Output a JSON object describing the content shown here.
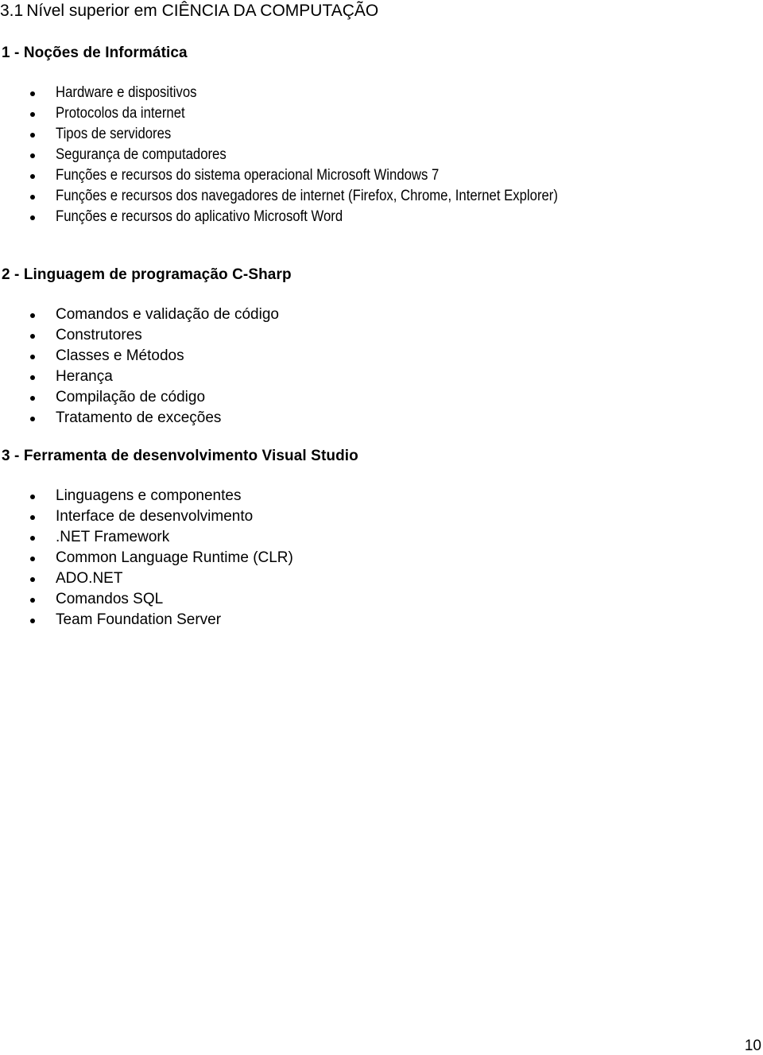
{
  "document": {
    "title_number": "3.1",
    "title_text": "Nível superior em CIÊNCIA DA COMPUTAÇÃO",
    "sections": [
      {
        "heading": "1 - Noções de Informática",
        "items": [
          "Hardware e dispositivos",
          "Protocolos da internet",
          "Tipos de servidores",
          "Segurança de computadores",
          "Funções e recursos do sistema operacional Microsoft Windows 7",
          "Funções e recursos dos navegadores de internet (Firefox, Chrome, Internet Explorer)",
          "Funções e recursos do aplicativo Microsoft Word"
        ]
      },
      {
        "heading": "2 - Linguagem de programação C-Sharp",
        "items": [
          "Comandos e validação de código",
          "Construtores",
          "Classes e Métodos",
          "Herança",
          "Compilação de código",
          "Tratamento de exceções"
        ]
      },
      {
        "heading": "3 - Ferramenta de desenvolvimento Visual Studio",
        "items": [
          "Linguagens e componentes",
          "Interface de desenvolvimento",
          ".NET Framework",
          "Common Language Runtime (CLR)",
          "ADO.NET",
          "Comandos SQL",
          "Team Foundation Server"
        ]
      }
    ],
    "page_number": "10"
  }
}
